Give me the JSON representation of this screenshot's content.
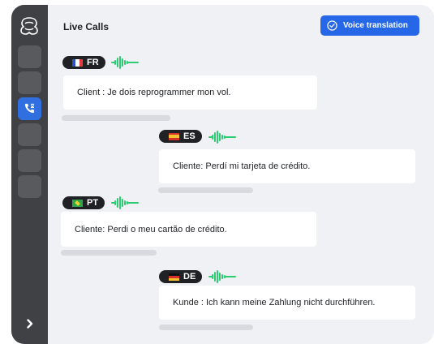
{
  "app": {
    "title": "Live Calls",
    "voice_translation_label": "Voice translation"
  },
  "icons": {
    "logo": "logo-icon",
    "phone": "phone-translate-icon",
    "chevron": "chevron-right-icon",
    "check": "check-circle-icon",
    "wave": "soundwave-icon"
  },
  "colors": {
    "accent": "#2567e6",
    "sidebar": "#404144",
    "wave": "#2ecc71"
  },
  "messages": [
    {
      "lang": "FR",
      "text": "Client : Je dois reprogrammer mon vol."
    },
    {
      "lang": "ES",
      "text": "Cliente: Perdí mi tarjeta de crédito."
    },
    {
      "lang": "PT",
      "text": "Cliente: Perdi o meu cartão de crédito."
    },
    {
      "lang": "DE",
      "text": "Kunde : Ich kann meine Zahlung nicht durchführen."
    }
  ]
}
